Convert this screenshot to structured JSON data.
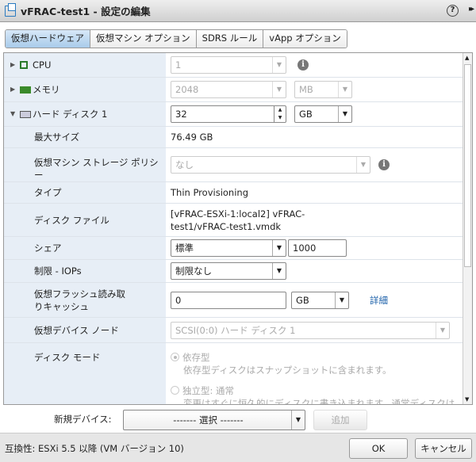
{
  "window": {
    "title": "vFRAC-test1 - 設定の編集",
    "help": "?",
    "expand": "▸▸"
  },
  "tabs": [
    {
      "label": "仮想ハードウェア",
      "active": true
    },
    {
      "label": "仮想マシン オプション"
    },
    {
      "label": "SDRS ルール"
    },
    {
      "label": "vApp オプション"
    }
  ],
  "hw": {
    "cpu": {
      "label": "CPU",
      "value": "1"
    },
    "memory": {
      "label": "メモリ",
      "value": "2048",
      "unit": "MB"
    },
    "disk": {
      "label": "ハード ディスク 1",
      "value": "32",
      "unit": "GB"
    },
    "max_size": {
      "label": "最大サイズ",
      "value": "76.49 GB"
    },
    "policy": {
      "label": "仮想マシン ストレージ ポリシー",
      "value": "なし"
    },
    "type": {
      "label": "タイプ",
      "value": "Thin Provisioning"
    },
    "file": {
      "label": "ディスク ファイル",
      "value_line1": "[vFRAC-ESXi-1:local2] vFRAC-",
      "value_line2": "test1/vFRAC-test1.vmdk"
    },
    "shares": {
      "label": "シェア",
      "level": "標準",
      "value": "1000"
    },
    "iops": {
      "label": "制限 - IOPs",
      "value": "制限なし"
    },
    "flash": {
      "label": "仮想フラッシュ読み取りキャッシュ",
      "value": "0",
      "unit": "GB",
      "details": "詳細"
    },
    "node": {
      "label": "仮想デバイス ノード",
      "value": "SCSI(0:0) ハード ディスク 1"
    },
    "mode": {
      "label": "ディスク モード",
      "opt1": "依存型",
      "opt1_desc": "依存型ディスクはスナップショットに含まれます。",
      "opt2": "独立型: 通常",
      "opt2_desc": "変更はすぐに恒久的にディスクに書き込まれます。通常ディスクは"
    }
  },
  "new_device": {
    "label": "新規デバイス:",
    "select": "------- 選択 -------",
    "add": "追加"
  },
  "footer": {
    "compat": "互換性: ESXi 5.5 以降 (VM バージョン 10)",
    "ok": "OK",
    "cancel": "キャンセル"
  }
}
